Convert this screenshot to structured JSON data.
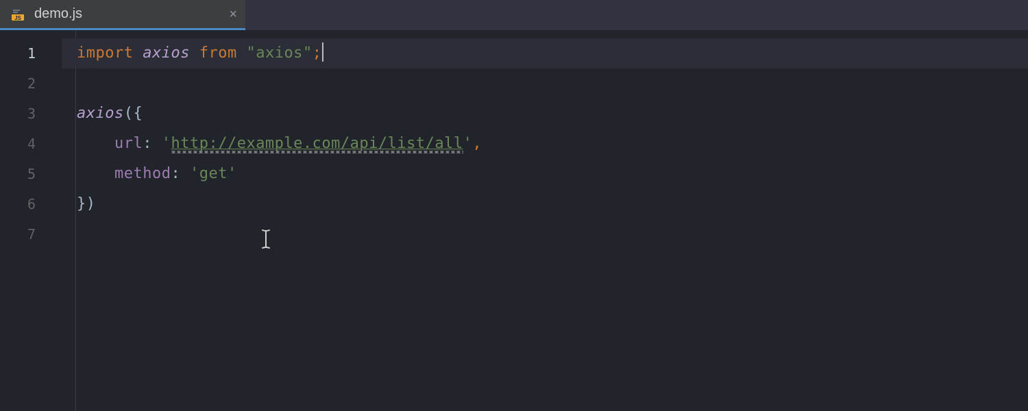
{
  "tab": {
    "file_name": "demo.js",
    "icon": "js-file-icon",
    "close_label": "×"
  },
  "gutter": {
    "line_numbers": [
      "1",
      "2",
      "3",
      "4",
      "5",
      "6",
      "7"
    ],
    "current_line_index": 0
  },
  "code": {
    "l1": {
      "import_kw": "import",
      "axios_ident": "axios",
      "from_kw": "from",
      "module_quote_open": "\"",
      "module_name": "axios",
      "module_quote_close": "\"",
      "semicolon": ";"
    },
    "l2": "",
    "l3": {
      "axios_call": "axios",
      "open": "({"
    },
    "l4": {
      "indent": "    ",
      "url_key": "url",
      "colon_sp": ": ",
      "q_open": "'",
      "url_value": "http://example.com/api/list/all",
      "q_close": "'",
      "comma": ","
    },
    "l5": {
      "indent": "    ",
      "method_key": "method",
      "colon_sp": ": ",
      "q_open": "'",
      "method_value": "get",
      "q_close": "'"
    },
    "l6": {
      "close": "})"
    },
    "l7": ""
  }
}
